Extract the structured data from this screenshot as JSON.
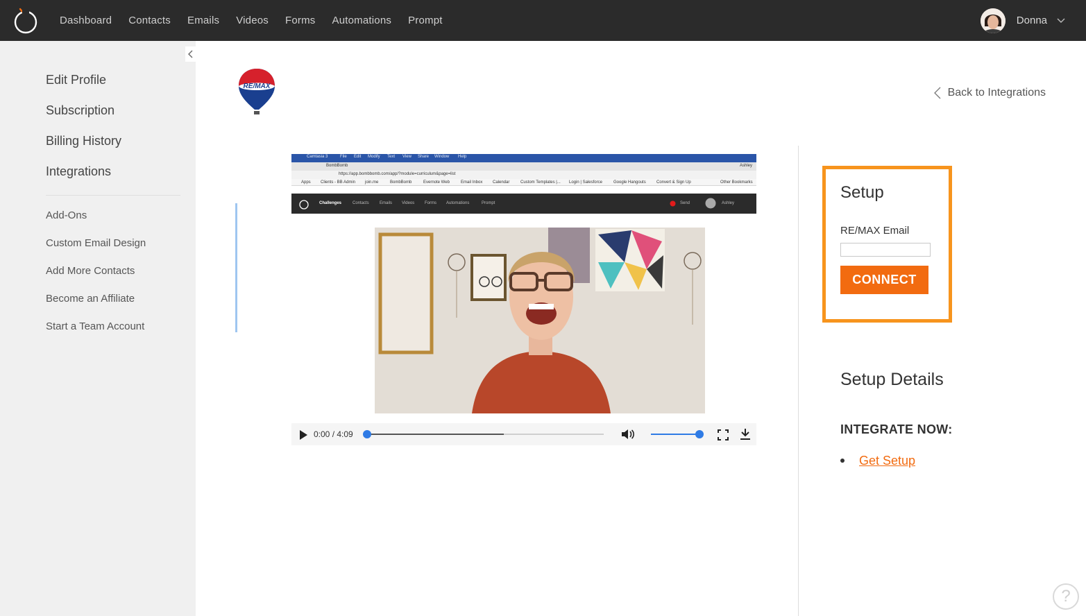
{
  "nav": {
    "items": [
      "Dashboard",
      "Contacts",
      "Emails",
      "Videos",
      "Forms",
      "Automations",
      "Prompt"
    ],
    "user_name": "Donna"
  },
  "sidebar": {
    "primary": [
      "Edit Profile",
      "Subscription",
      "Billing History",
      "Integrations"
    ],
    "secondary": [
      "Add-Ons",
      "Custom Email Design",
      "Add More Contacts",
      "Become an Affiliate",
      "Start a Team Account"
    ]
  },
  "main": {
    "brand_logo_text": "RE/MAX",
    "back_link": "Back to Integrations"
  },
  "video": {
    "time": "0:00 / 4:09",
    "progress_fraction": 0.0,
    "buffered_fraction": 0.58,
    "volume_fraction": 1.0,
    "embedded_screenshot": {
      "menubar": [
        "Camtasia 3",
        "File",
        "Edit",
        "Modify",
        "Text",
        "View",
        "Share",
        "Window",
        "Help"
      ],
      "tab_title": "BombBomb",
      "tab_user": "Ashley",
      "url": "https://app.bombbomb.com/app/?module=curriculum&page=list",
      "bookmarks": [
        "Apps",
        "Clients - BB Admin",
        "join.me",
        "BombBomb",
        "Evernote Web",
        "Email Inbox",
        "Calendar",
        "Custom Templates |...",
        "Login | Salesforce",
        "Google Hangouts",
        "Convert & Sign Up",
        "Other Bookmarks"
      ],
      "app_nav": [
        "Challenges",
        "Contacts",
        "Emails",
        "Videos",
        "Forms",
        "Automations",
        "Prompt"
      ],
      "send_label": "Send",
      "user_label": "Ashley"
    }
  },
  "setup": {
    "title": "Setup",
    "email_label": "RE/MAX Email",
    "email_value": "",
    "connect_label": "CONNECT"
  },
  "details": {
    "title": "Setup Details",
    "integrate_heading": "INTEGRATE NOW:",
    "link_label": "Get Setup"
  },
  "help": {
    "label": "?"
  },
  "colors": {
    "accent_orange": "#f26b10",
    "setup_border": "#f7941d",
    "topbar": "#2b2b2b",
    "sidebar": "#f0f0f0",
    "player_blue": "#2f7be5"
  }
}
